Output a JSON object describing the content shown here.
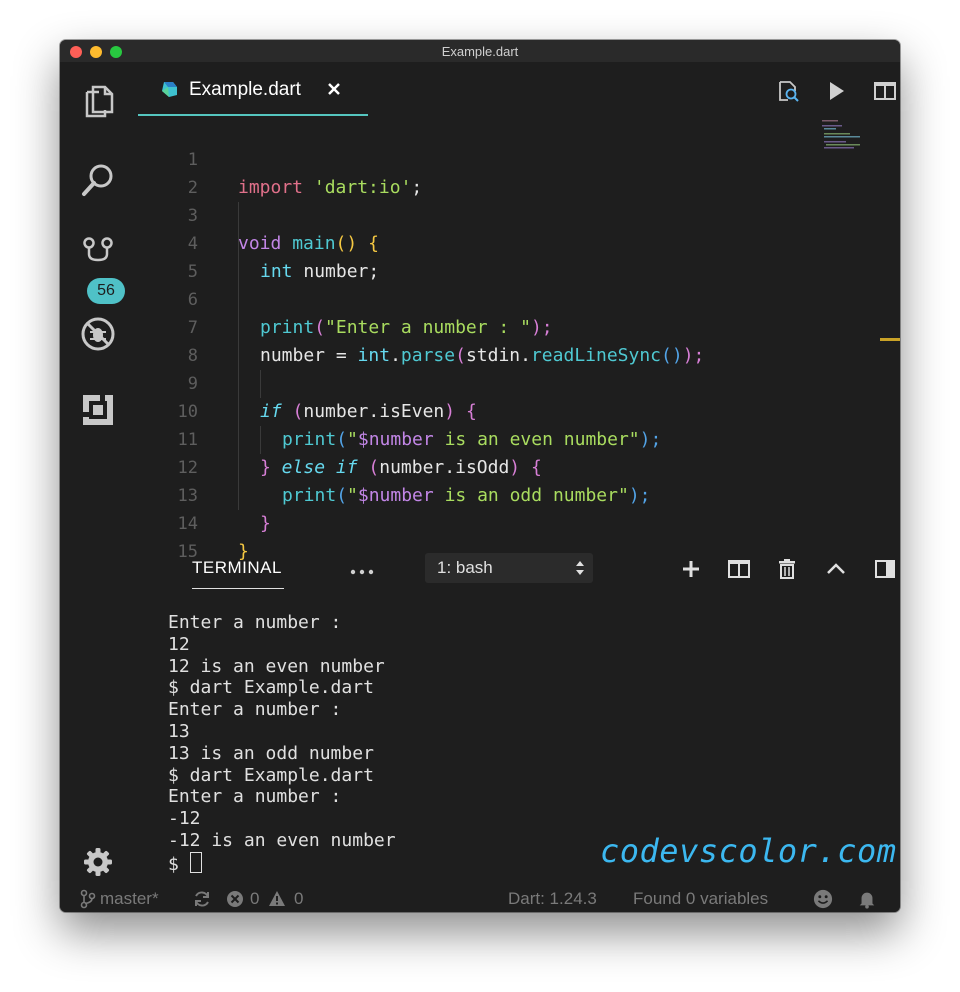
{
  "window": {
    "title": "Example.dart"
  },
  "activity": {
    "source_control_badge": "56"
  },
  "editor": {
    "tab_label": "Example.dart",
    "line_numbers": [
      "1",
      "2",
      "3",
      "4",
      "5",
      "6",
      "7",
      "8",
      "9",
      "10",
      "11",
      "12",
      "13",
      "14",
      "15"
    ],
    "code": {
      "l1": {
        "a": "import",
        "b": " 'dart:io'",
        "c": ";"
      },
      "l3": {
        "a": "void",
        "b": " main",
        "c": "()",
        "d": " {"
      },
      "l4": {
        "a": "int",
        "b": " number;"
      },
      "l6": {
        "a": "print",
        "b": "(",
        "c": "\"Enter a number : \"",
        "d": ");"
      },
      "l7": {
        "a": "number = ",
        "b": "int",
        "c": ".",
        "d": "parse",
        "e": "(",
        "f": "stdin",
        "g": ".",
        "h": "readLineSync",
        "i": "()",
        "j": ");"
      },
      "l9": {
        "a": "if",
        "b": " (",
        "c": "number",
        "d": ".",
        "e": "isEven",
        "f": ")",
        "g": " {"
      },
      "l10": {
        "a": "print",
        "b": "(",
        "c": "\"",
        "d": "$number",
        "e": " is an even number\"",
        "f": ");"
      },
      "l11": {
        "a": "}",
        "b": " else",
        "c": " if",
        "d": " (",
        "e": "number",
        "f": ".",
        "g": "isOdd",
        "h": ")",
        "i": " {"
      },
      "l12": {
        "a": "print",
        "b": "(",
        "c": "\"",
        "d": "$number",
        "e": " is an odd number\"",
        "f": ");"
      },
      "l13": {
        "a": "}"
      },
      "l14": {
        "a": "}"
      }
    }
  },
  "panel": {
    "terminal_tab": "TERMINAL",
    "more": "•••",
    "shell_select": "1: bash"
  },
  "terminal": {
    "lines": [
      "Enter a number :",
      "12",
      "12 is an even number",
      "$ dart Example.dart",
      "Enter a number :",
      "13",
      "13 is an odd number",
      "$ dart Example.dart",
      "Enter a number :",
      "-12",
      "-12 is an even number"
    ],
    "prompt": "$ "
  },
  "watermark": "codevscolor.com",
  "statusbar": {
    "branch": "master*",
    "errors": "0",
    "warnings": "0",
    "dart_version": "Dart: 1.24.3",
    "variables": "Found 0 variables"
  },
  "colors": {
    "accent": "#55c5bf",
    "badge": "#4fc1c7",
    "watermark": "#3cb8f0"
  }
}
